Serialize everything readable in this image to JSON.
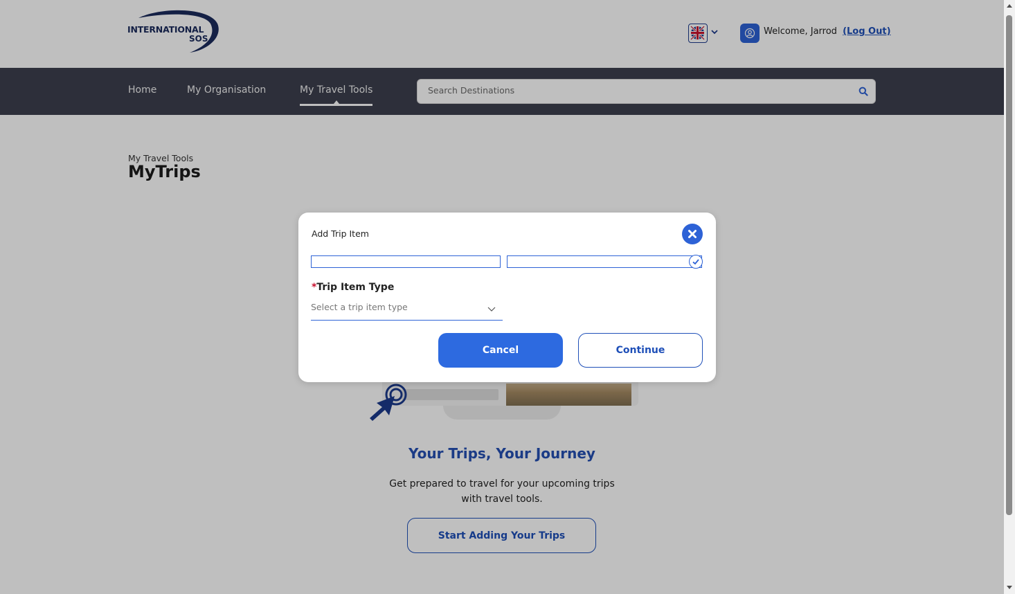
{
  "brand": {
    "logo_line1": "INTERNATIONAL",
    "logo_line2": "SOS",
    "accent_color": "#2d62d6",
    "nav_bg": "#3c3f4e"
  },
  "header": {
    "language_icon": "uk-flag-icon",
    "welcome_text": "Welcome, Jarrod",
    "logout_label": "(Log Out)"
  },
  "nav": {
    "items": [
      {
        "label": "Home"
      },
      {
        "label": "My Organisation"
      },
      {
        "label": "My Travel Tools",
        "active": true
      }
    ],
    "search_placeholder": "Search Destinations"
  },
  "page": {
    "breadcrumb": "My Travel Tools",
    "title": "MyTrips",
    "tagline": "Your Trips, Your Journey",
    "description": "Get prepared to travel for your upcoming trips with travel tools.",
    "start_button": "Start Adding Your Trips"
  },
  "modal": {
    "title": "Add Trip Item",
    "field_label": "Trip Item Type",
    "required_marker": "*",
    "select_placeholder": "Select a trip item type",
    "cancel_label": "Cancel",
    "continue_label": "Continue"
  }
}
